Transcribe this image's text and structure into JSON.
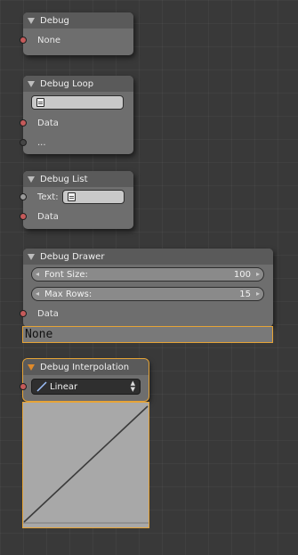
{
  "nodes": {
    "debug": {
      "title": "Debug",
      "socket_label": "None"
    },
    "debug_loop": {
      "title": "Debug Loop",
      "inputs": [
        "Data",
        "..."
      ]
    },
    "debug_list": {
      "title": "Debug List",
      "text_label": "Text:",
      "data_label": "Data"
    },
    "debug_drawer": {
      "title": "Debug Drawer",
      "font_size": {
        "label": "Font Size:",
        "value": "100"
      },
      "max_rows": {
        "label": "Max Rows:",
        "value": "15"
      },
      "data_label": "Data",
      "output_text": "None"
    },
    "debug_interpolation": {
      "title": "Debug Interpolation",
      "selected": "Linear"
    }
  },
  "icons": {
    "collapse": "triangle-down-icon",
    "text_block": "document-icon",
    "interpolation": "linear-icon",
    "dropdown": "up-down-arrows-icon"
  },
  "colors": {
    "background": "#393939",
    "node_body": "#6e6e6e",
    "node_header": "#5a5a5a",
    "socket_data": "#c55a5a",
    "selection": "#e6a437"
  }
}
